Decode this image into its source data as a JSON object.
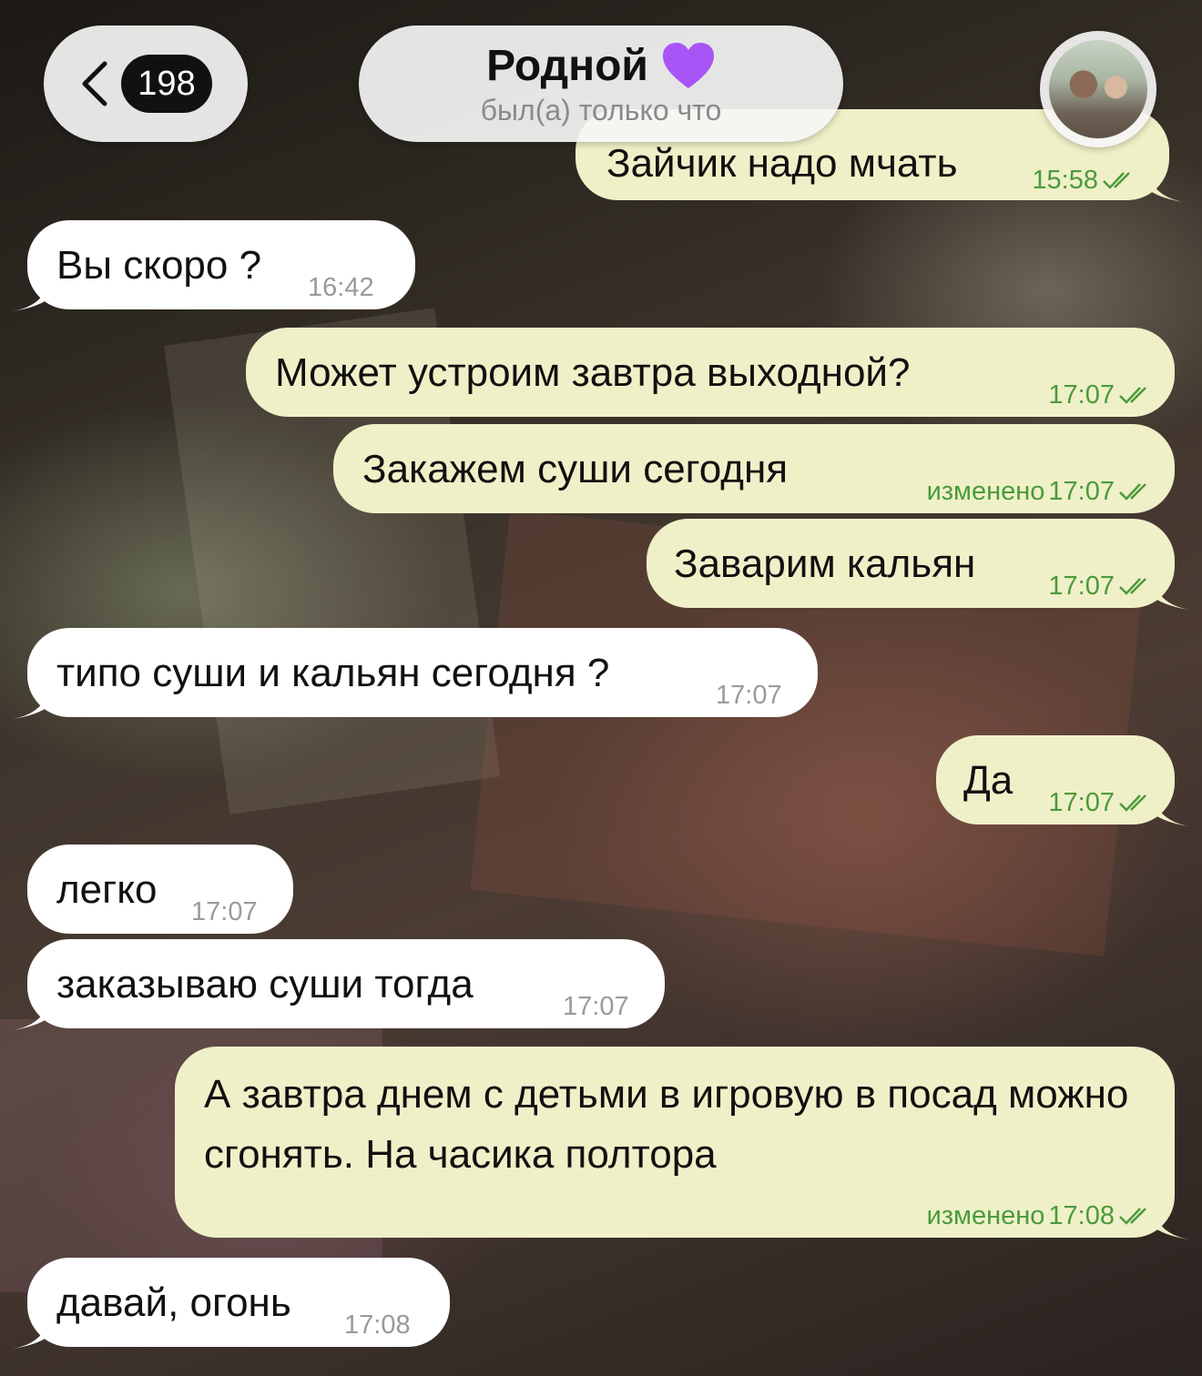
{
  "header": {
    "unread_count": "198",
    "contact_name": "Родной",
    "status": "был(а) только что"
  },
  "colors": {
    "outgoing_bubble": "#f0f0c8",
    "incoming_bubble": "#ffffff",
    "outgoing_meta": "#4a9a3c",
    "heart": "#a855f7"
  },
  "messages": [
    {
      "direction": "out",
      "text": "Зайчик надо мчать",
      "time": "15:58",
      "edited": "",
      "read": true
    },
    {
      "direction": "in",
      "text": "Вы скоро ?",
      "time": "16:42",
      "edited": ""
    },
    {
      "direction": "out",
      "text": "Может устроим завтра выходной?",
      "time": "17:07",
      "edited": "",
      "read": true
    },
    {
      "direction": "out",
      "text": "Закажем суши сегодня",
      "time": "17:07",
      "edited": "изменено",
      "read": true
    },
    {
      "direction": "out",
      "text": "Заварим кальян",
      "time": "17:07",
      "edited": "",
      "read": true
    },
    {
      "direction": "in",
      "text": "типо суши и кальян сегодня ?",
      "time": "17:07",
      "edited": ""
    },
    {
      "direction": "out",
      "text": "Да",
      "time": "17:07",
      "edited": "",
      "read": true
    },
    {
      "direction": "in",
      "text": "легко",
      "time": "17:07",
      "edited": ""
    },
    {
      "direction": "in",
      "text": "заказываю суши тогда",
      "time": "17:07",
      "edited": ""
    },
    {
      "direction": "out",
      "text": "А завтра днем с детьми в игровую в посад можно сгонять. На часика полтора",
      "time": "17:08",
      "edited": "изменено",
      "read": true
    },
    {
      "direction": "in",
      "text": "давай, огонь",
      "time": "17:08",
      "edited": ""
    }
  ]
}
